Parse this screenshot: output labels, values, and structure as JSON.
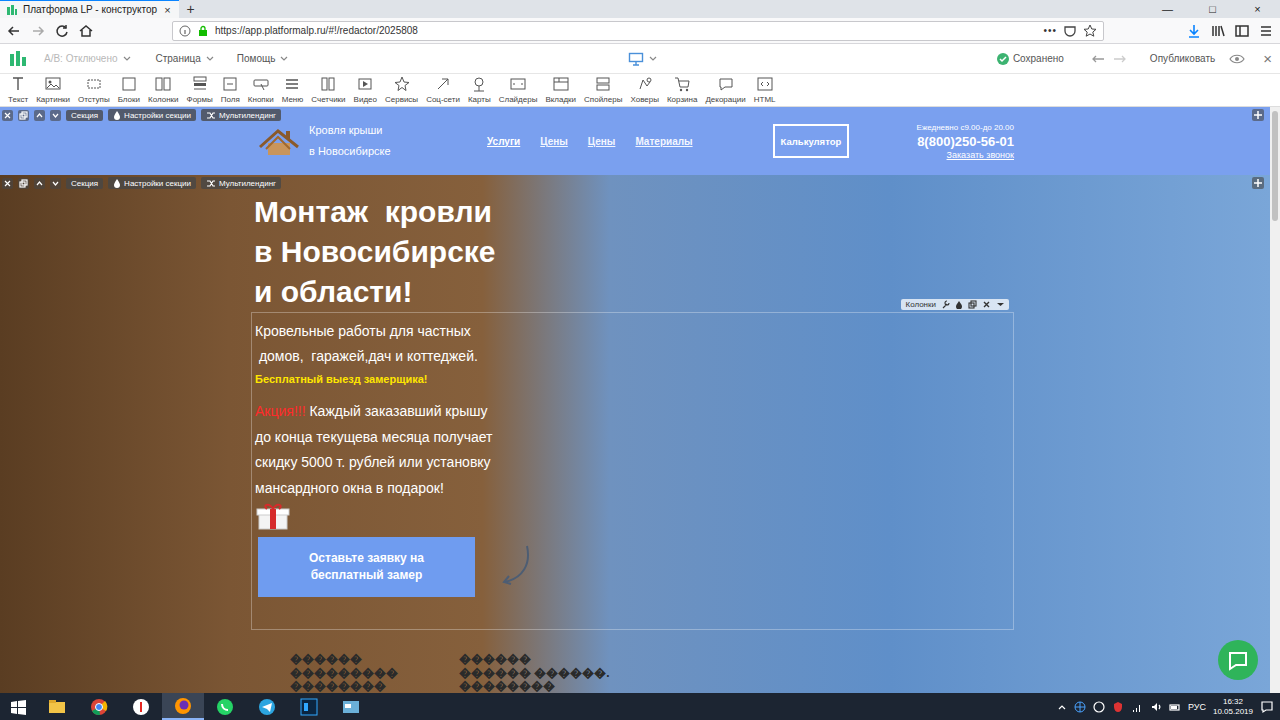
{
  "browser": {
    "tabs": [
      {
        "label": "Платформа LP - конструктор",
        "close": "×",
        "selected": true
      }
    ],
    "new_tab": "+",
    "window_controls": [
      "—",
      "□",
      "×"
    ],
    "url": "https://app.platformalp.ru/#!/redactor/2025808",
    "more": "•••"
  },
  "editor": {
    "ab": "A/B: Отключено",
    "ab_disabled": true,
    "menus": [
      "Страница",
      "Помощь"
    ],
    "saved": "Сохранено",
    "publish": "Опубликовать",
    "close": "×"
  },
  "toolbar": [
    "Текст",
    "Картинки",
    "Отступы",
    "Блоки",
    "Колонки",
    "Формы",
    "Поля",
    "Кнопки",
    "Меню",
    "Счетчики",
    "Видео",
    "Сервисы",
    "Соц-сети",
    "Карты",
    "Слайдеры",
    "Вкладки",
    "Спойлеры",
    "Ховеры",
    "Корзина",
    "Декорации",
    "HTML"
  ],
  "section_bars": [
    {
      "section": "Секция",
      "settings": "Настройки секции",
      "multi": "Мультилендинг"
    },
    {
      "section": "Секция",
      "settings": "Настройки секции",
      "multi": "Мультилендинг"
    }
  ],
  "header": {
    "logo_lines": [
      "Кровля крыши",
      "в Новосибирске"
    ],
    "nav": [
      {
        "label": "Услуги",
        "selected": true
      },
      {
        "label": "Цены",
        "selected": false
      },
      {
        "label": "Цены",
        "selected": false
      },
      {
        "label": "Материалы",
        "selected": false
      }
    ],
    "calc": "Калькулятор",
    "hours": "Ежедневно с9.00-до 20.00",
    "phone": "8(800)250-56-01",
    "callback": "Заказать звонок"
  },
  "hero": {
    "title_lines": [
      "Монтаж  кровли",
      "в Новосибирске",
      "и области!"
    ],
    "columns_label": "Колонки",
    "intro_lines": [
      "Кровельные работы для частных",
      " домов,  гаражей,дач и коттеджей."
    ],
    "free_visit": "Бесплатный выезд замерщика!",
    "promo_label": "Акция!!!",
    "promo_lines": [
      " Каждый заказавший крышу",
      "до конца текущева месяца получает",
      "скидку 5000 т. рублей или установку",
      "мансардного окна в подарок!"
    ],
    "cta": "Оставьте заявку на бесплатный замер",
    "garbled_columns": [
      [
        "������",
        "���������",
        "��������"
      ],
      [
        "������",
        "������ ������.",
        "��������"
      ]
    ]
  },
  "taskbar": {
    "lang": "РУС",
    "time": "16:32",
    "date": "10.05.2019"
  }
}
